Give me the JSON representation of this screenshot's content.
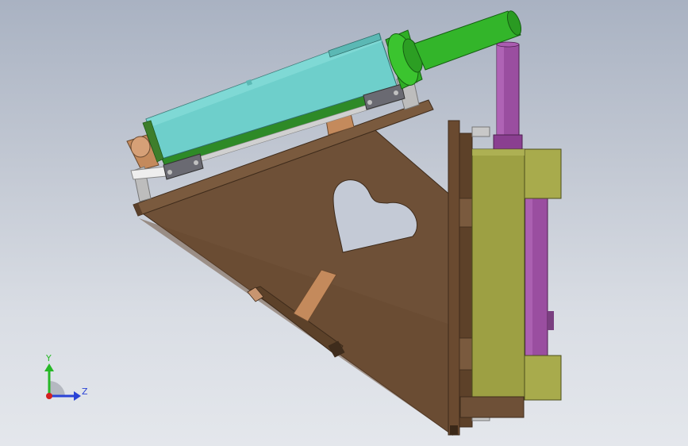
{
  "viewport": {
    "background_top": "#a9b2c2",
    "background_bottom": "#e4e7ec"
  },
  "model": {
    "parts": [
      "triangular-wooden-bracket",
      "heart-cutout",
      "top-mounting-plate",
      "cyan-linear-actuator",
      "green-motor-shaft",
      "olive-slide-block",
      "purple-vertical-cylinder",
      "vertical-rail-plate",
      "diagonal-brace"
    ],
    "colors": {
      "wood": "#6e5037",
      "wood_dark": "#4d3624",
      "wood_light": "#b98a62",
      "cyan": "#6ecfcb",
      "green": "#33b52a",
      "olive": "#9da043",
      "purple": "#9a4ea0",
      "steel": "#c9c9c9"
    }
  },
  "triad": {
    "y_label": "Y",
    "z_label": "Z",
    "y_color": "#27b827",
    "z_color": "#2a43d6",
    "origin_color": "#d42020"
  }
}
